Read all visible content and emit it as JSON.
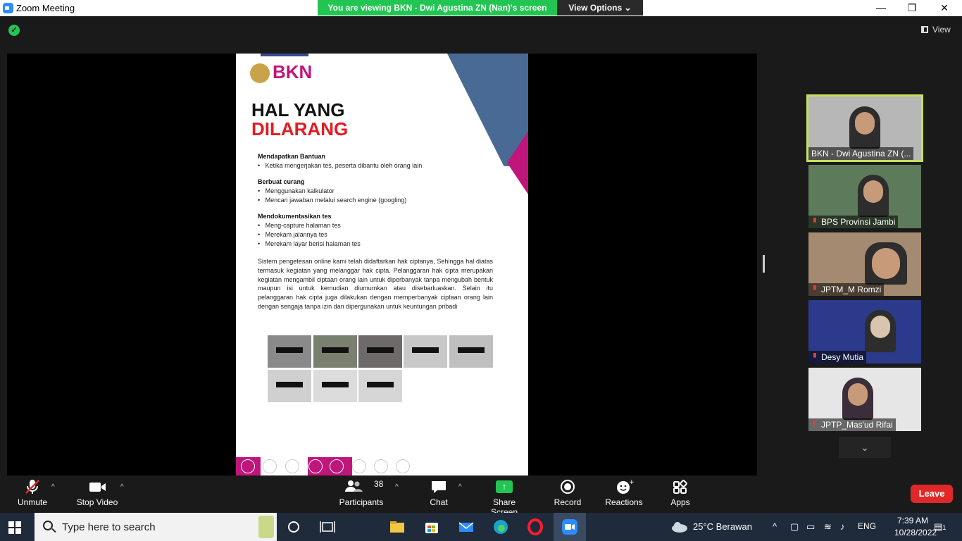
{
  "window": {
    "title": "Zoom Meeting",
    "share_banner": "You are viewing BKN - Dwi Agustina ZN (Nan)'s screen",
    "view_options": "View Options",
    "minimize": "—",
    "maximize": "❐",
    "close": "✕"
  },
  "header": {
    "view_label": "View"
  },
  "document": {
    "brand": "BKN",
    "title_line1": "HAL YANG",
    "title_line2": "DILARANG",
    "sections": [
      {
        "title": "Mendapatkan Bantuan",
        "bullets": [
          "Ketika mengerjakan tes, peserta dibantu oleh orang lain"
        ]
      },
      {
        "title": "Berbuat curang",
        "bullets": [
          "Menggunakan kalkulator",
          "Mencari jawaban melalui search engine (googling)"
        ]
      },
      {
        "title": "Mendokumentasikan tes",
        "bullets": [
          "Meng-capture halaman tes",
          "Merekam jalannya tes",
          "Merekam layar berisi halaman tes"
        ]
      }
    ],
    "paragraph": "Sistem pengetesan online kami telah didaftarkan hak ciptanya, Sehingga hal diatas termasuk kegiatan yang melanggar hak cipta. Pelanggaran hak cipta merupakan kegiatan mengambil ciptaan orang lain untuk diperbanyak tanpa mengubah bentuk maupun isi untuk kemudian diumumkan atau disebarluaskan. Selain itu pelanggaran hak cipta juga dilakukan dengan memperbanyak ciptaan orang lain dengan sengaja tanpa izin dan dipergunakan untuk keuntungan pribadi"
  },
  "participants_panel": [
    {
      "name": "BKN - Dwi Agustina ZN (...",
      "muted": false,
      "active": true
    },
    {
      "name": "BPS Provinsi Jambi",
      "muted": true,
      "active": false
    },
    {
      "name": "JPTM_M Romzi",
      "muted": true,
      "active": false
    },
    {
      "name": "Desy Mutia",
      "muted": true,
      "active": false
    },
    {
      "name": "JPTP_Mas'ud Rifai",
      "muted": true,
      "active": false
    }
  ],
  "toolbar": {
    "unmute": "Unmute",
    "stop_video": "Stop Video",
    "participants": "Participants",
    "participants_count": "38",
    "chat": "Chat",
    "share_screen": "Share Screen",
    "record": "Record",
    "reactions": "Reactions",
    "apps": "Apps",
    "leave": "Leave"
  },
  "taskbar": {
    "search_placeholder": "Type here to search",
    "weather": "25°C  Berawan",
    "language": "ENG",
    "time": "7:39 AM",
    "date": "10/28/2022",
    "notifications": "1"
  },
  "colors": {
    "zoom_green": "#23c552",
    "brand_magenta": "#c0157b",
    "title_red": "#e31b23",
    "leave_red": "#e02828"
  }
}
